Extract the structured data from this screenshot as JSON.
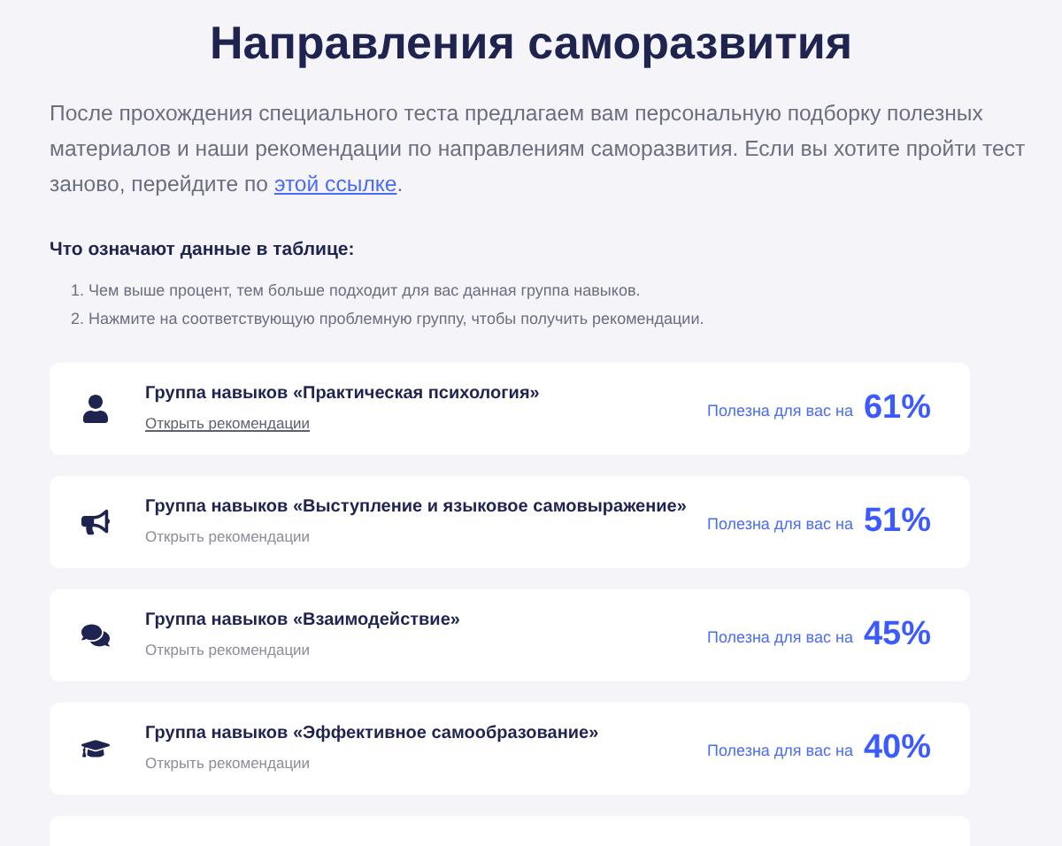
{
  "title": "Направления саморазвития",
  "intro": {
    "text": "После прохождения специального теста предлагаем вам персональную подборку полезных материалов и наши рекомендации по направлениям саморазвития. Если вы хотите пройти тест заново, перейдите по",
    "link": "этой ссылке",
    "after": "."
  },
  "legend": {
    "heading": "Что означают данные в таблице:",
    "items": [
      "1. Чем выше процент, тем больше подходит для вас данная группа навыков.",
      "2. Нажмите на соответствующую проблемную группу, чтобы получить рекомендации."
    ]
  },
  "groups": [
    {
      "title": "Группа навыков «Практическая психология»",
      "link": "Открыть рекомендации",
      "hovered": true,
      "label": "Полезна для вас на",
      "percent": "61%"
    },
    {
      "title": "Группа навыков «Выступление и языковое самовыражение»",
      "link": "Открыть рекомендации",
      "hovered": false,
      "label": "Полезна для вас на",
      "percent": "51%"
    },
    {
      "title": "Группа навыков «Взаимодействие»",
      "link": "Открыть рекомендации",
      "hovered": false,
      "label": "Полезна для вас на",
      "percent": "45%"
    },
    {
      "title": "Группа навыков «Эффективное самообразование»",
      "link": "Открыть рекомендации",
      "hovered": false,
      "label": "Полезна для вас на",
      "percent": "40%"
    }
  ]
}
